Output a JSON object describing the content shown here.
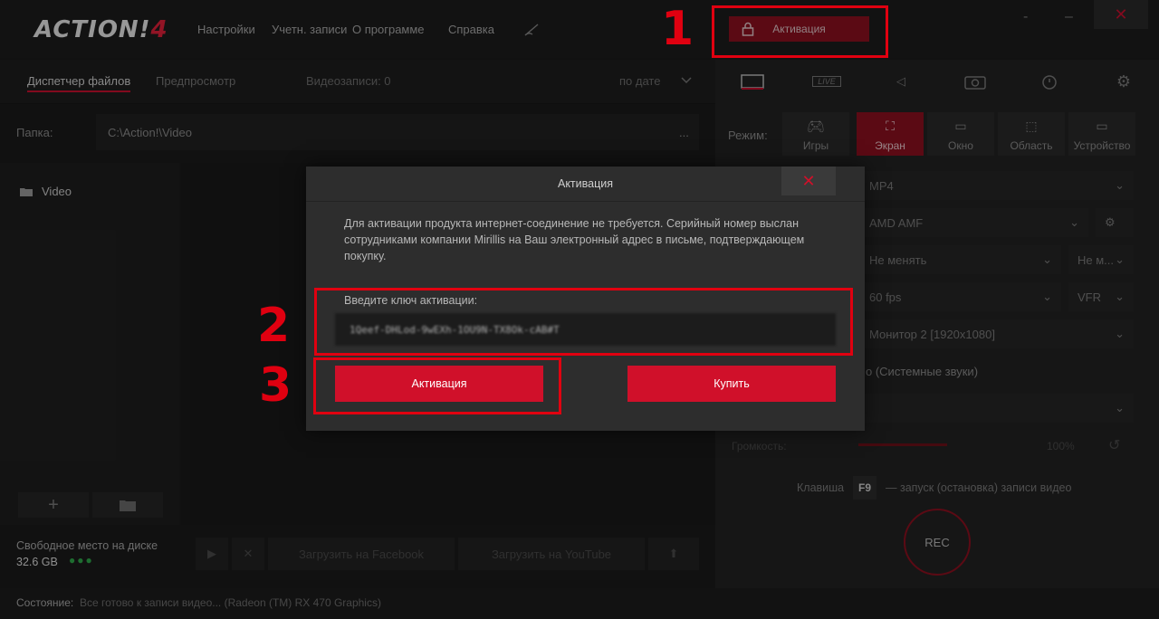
{
  "app": {
    "logo_main": "ACTION!",
    "logo_version": "4",
    "menu": [
      "Настройки",
      "Учетн. записи",
      "О программе",
      "Справка"
    ],
    "activation_top": "Активация",
    "window_controls": {
      "minimize": "-",
      "maximize": "–",
      "close": "✕"
    }
  },
  "left": {
    "tabs": {
      "files": "Диспетчер файлов",
      "preview": "Предпросмотр"
    },
    "video_count": "Видеозаписи: 0",
    "sort": "по дате",
    "folder_label": "Папка:",
    "folder_path": "C:\\Action!\\Video",
    "folder_more": "...",
    "tree_item": "Video",
    "free_space_label": "Свободное место на диске",
    "free_space_value": "32.6 GB",
    "upload_facebook": "Загрузить на Facebook",
    "upload_youtube": "Загрузить на YouTube",
    "status_label": "Состояние:",
    "status_text": "Все готово к записи видео... (Radeon (TM) RX 470 Graphics)"
  },
  "right": {
    "tabs": [
      "video-tab",
      "LIVE",
      "audio-tab",
      "camera-tab",
      "timer-tab",
      "settings-tab"
    ],
    "mode_label": "Режим:",
    "modes": [
      "Игры",
      "Экран",
      "Окно",
      "Область",
      "Устройство"
    ],
    "active_mode": "Экран",
    "format": "MP4",
    "encoder": "AMD AMF",
    "resolution": "Не менять",
    "resolution_extra": "Не м...",
    "fps": "60 fps",
    "fps_mode": "VFR",
    "monitor": "Монитор 2 [1920x1080]",
    "audio": "о (Системные звуки)",
    "volume_label": "Громкость:",
    "volume_value": "100%",
    "hotkey_label": "Клавиша",
    "hotkey_key": "F9",
    "hotkey_text": "— запуск (остановка) записи видео",
    "rec": "REC"
  },
  "dialog": {
    "title": "Активация",
    "description": "Для активации продукта интернет-соединение не требуется. Серийный номер выслан сотрудниками компании Mirillis на Ваш электронный адрес в письме, подтверждающем покупку.",
    "key_label": "Введите ключ активации:",
    "key_value": "1Qeef-DHLod-9wEXh-1OU9N-TX8Ok-cAB#T",
    "activate_button": "Активация",
    "buy_button": "Купить"
  },
  "annotations": {
    "one": "1",
    "two": "2",
    "three": "3"
  },
  "colors": {
    "accent": "#d0102a",
    "annotation": "#e00010",
    "background": "#1b1b1b"
  }
}
